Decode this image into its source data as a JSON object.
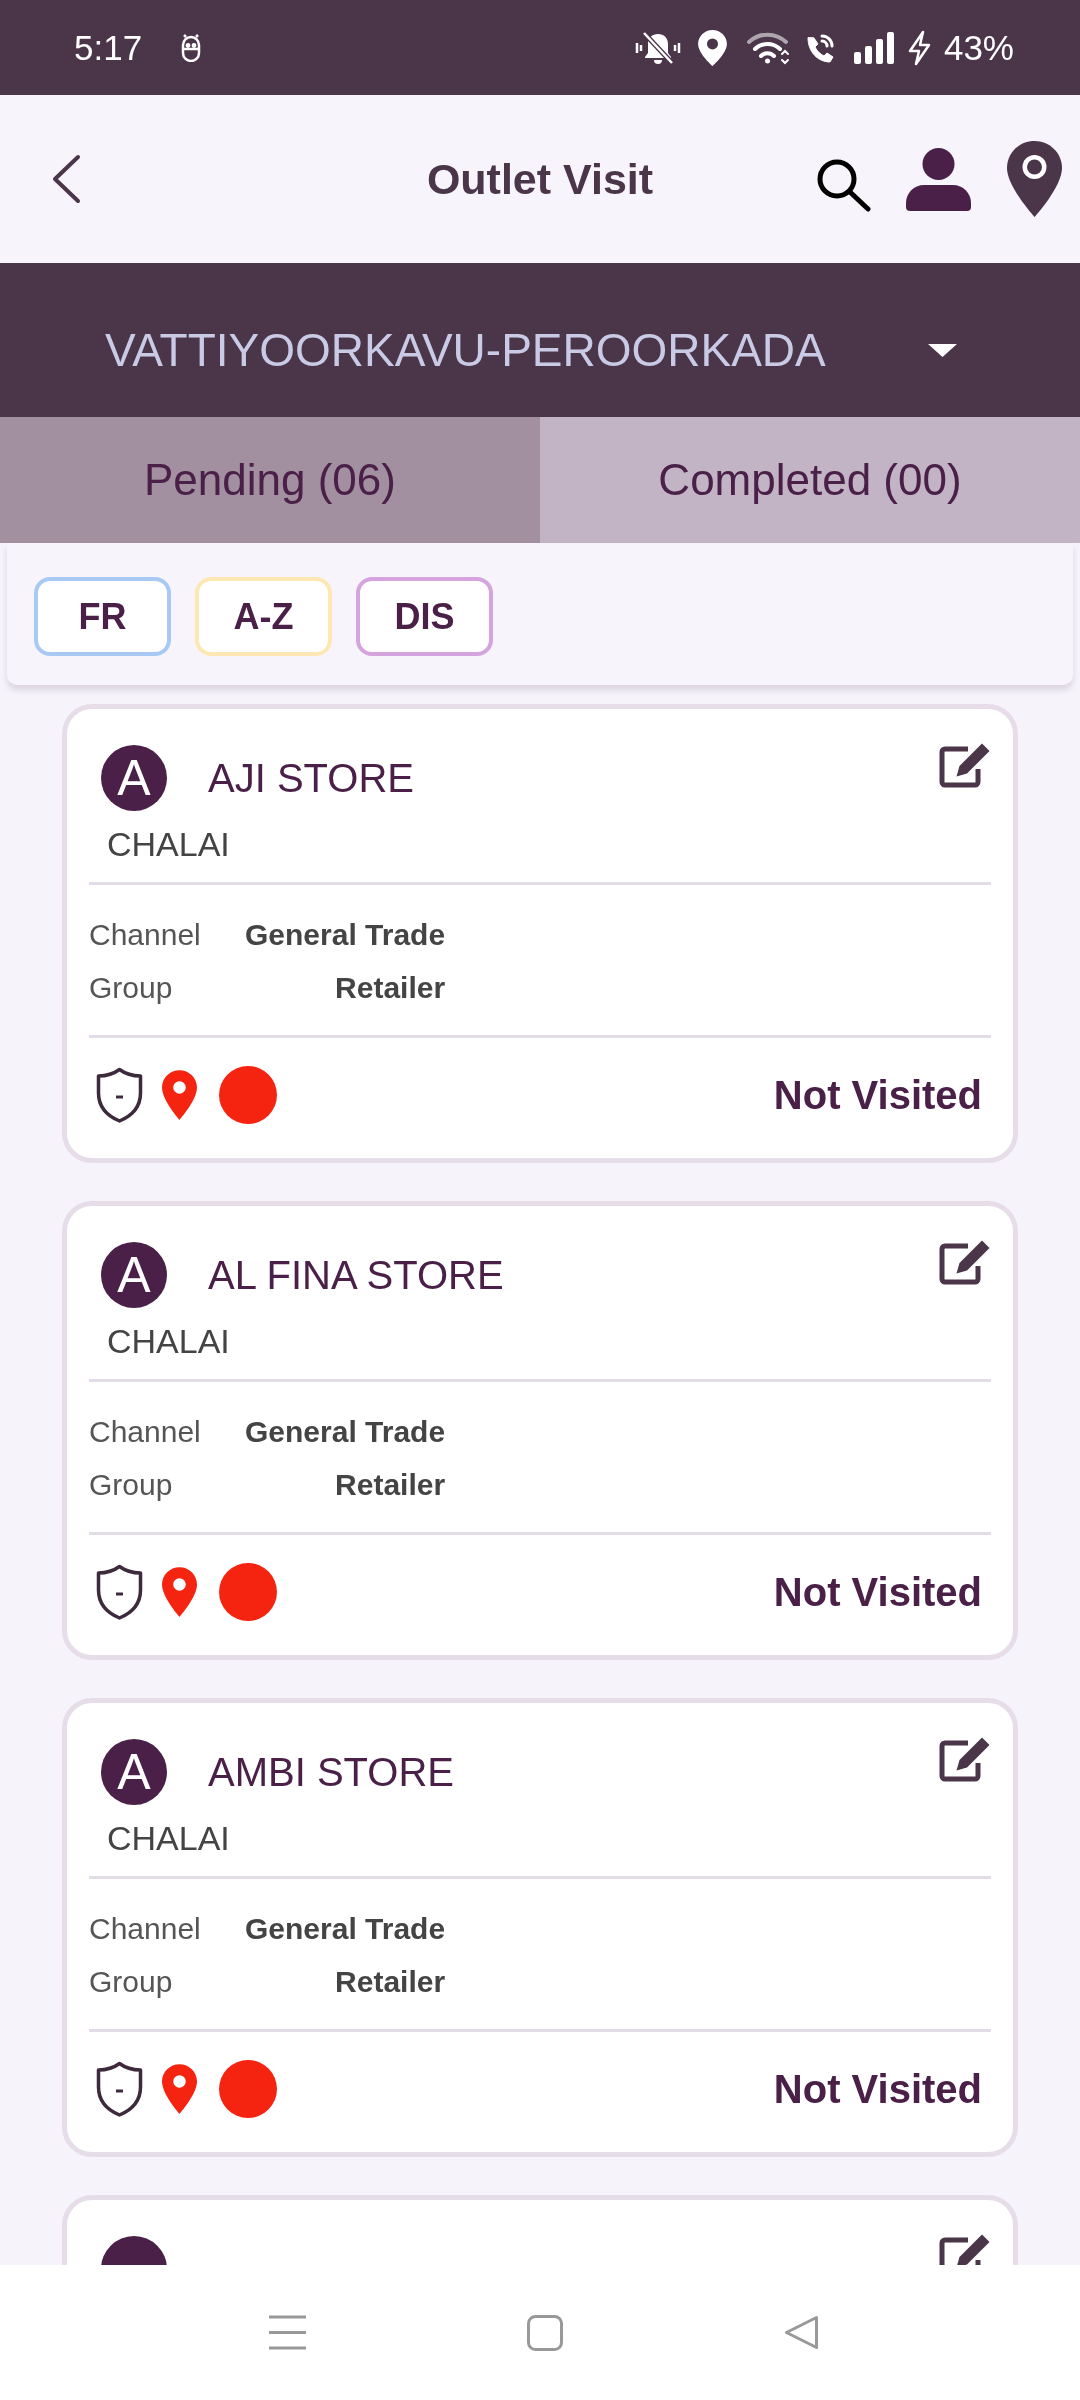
{
  "status_bar": {
    "time": "5:17",
    "battery": "43%"
  },
  "header": {
    "title": "Outlet Visit"
  },
  "route_selector": {
    "value": "VATTIYOORKAVU-PEROORKADA"
  },
  "tabs": [
    {
      "label": "Pending (06)",
      "selected": true
    },
    {
      "label": "Completed (00)",
      "selected": false
    }
  ],
  "filters": [
    {
      "label": "FR",
      "color": "#a9c9f5"
    },
    {
      "label": "A-Z",
      "color": "#fde8b4"
    },
    {
      "label": "DIS",
      "color": "#d5a3dd"
    }
  ],
  "outlets": [
    {
      "kind": "full",
      "initial": "A",
      "name": "AJI STORE",
      "area": "CHALAI",
      "details": [
        {
          "label": "Channel",
          "value": "General Trade"
        },
        {
          "label": "Group",
          "value": "Retailer"
        }
      ],
      "status": "Not Visited",
      "color": "#f52410"
    },
    {
      "kind": "full",
      "initial": "A",
      "name": "AL FINA STORE",
      "area": "CHALAI",
      "details": [
        {
          "label": "Channel",
          "value": "General Trade"
        },
        {
          "label": "Group",
          "value": "Retailer"
        }
      ],
      "status": "Not Visited",
      "color": "#f52410"
    },
    {
      "kind": "full",
      "initial": "A",
      "name": "AMBI STORE",
      "area": "CHALAI",
      "details": [
        {
          "label": "Channel",
          "value": "General Trade"
        },
        {
          "label": "Group",
          "value": "Retailer"
        }
      ],
      "status": "Not Visited",
      "color": "#f52410"
    },
    {
      "kind": "cut"
    }
  ]
}
